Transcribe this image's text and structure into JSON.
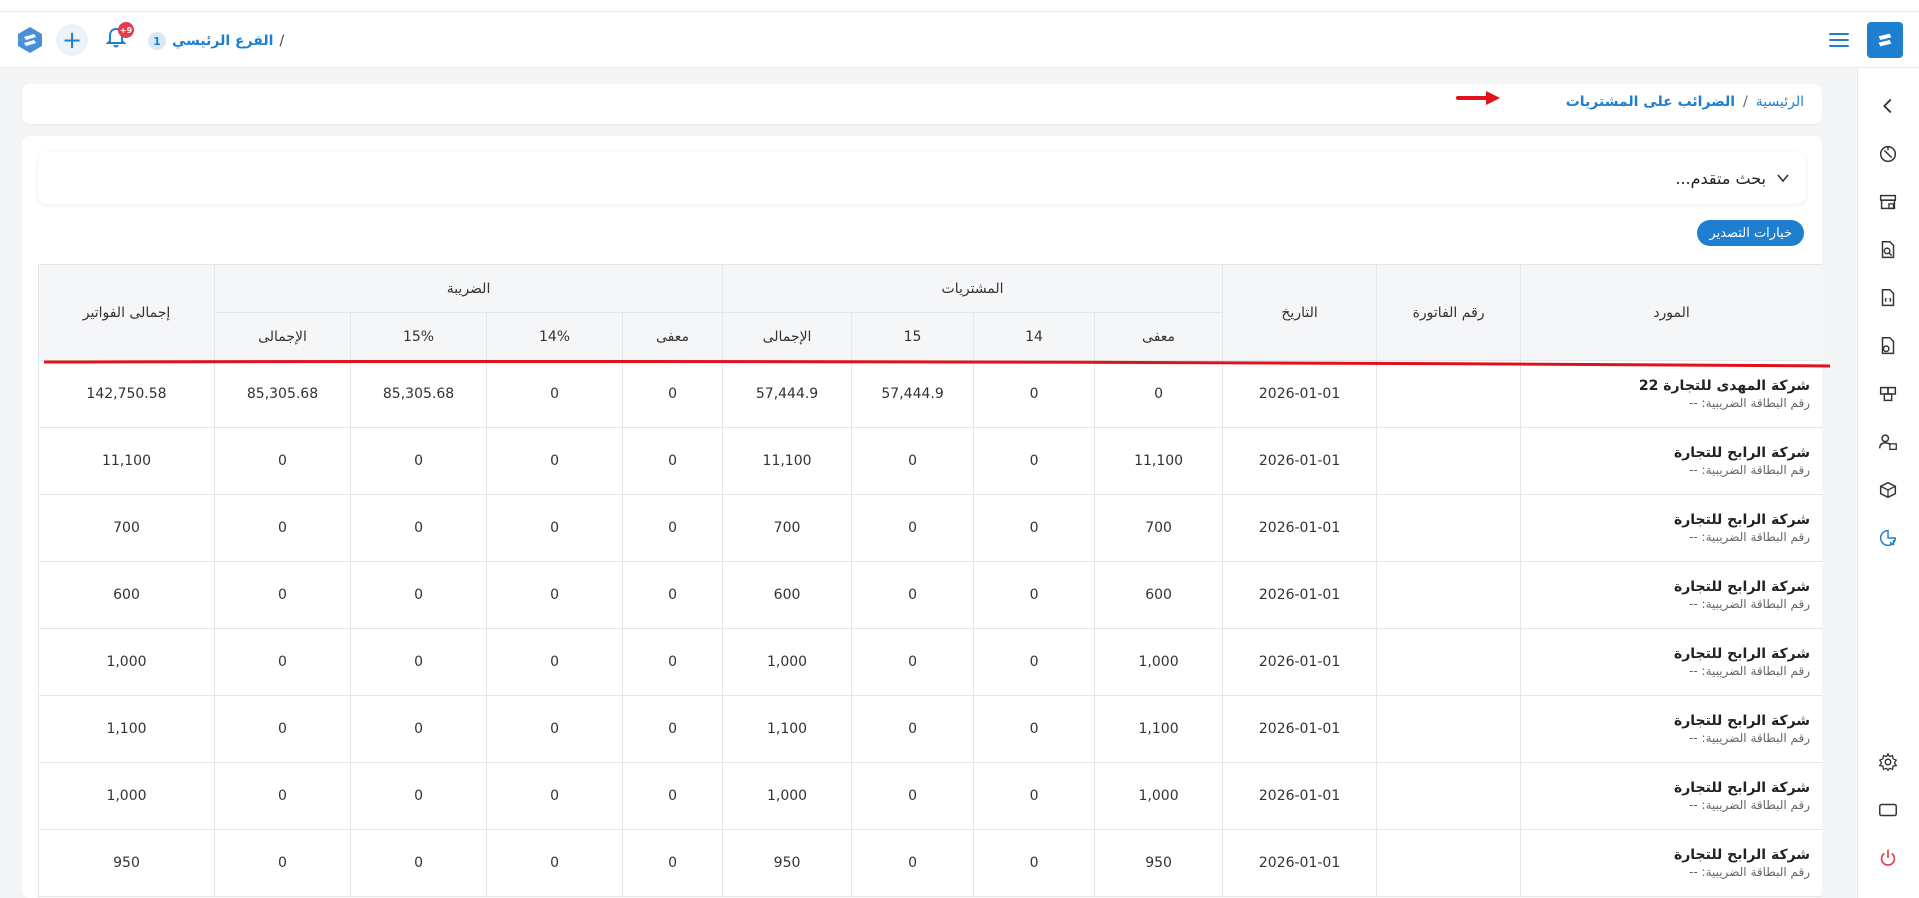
{
  "header": {
    "branch_number": "1",
    "branch_name": "الفرع الرئيسي",
    "branch_sep": "/",
    "notification_count": "+9"
  },
  "breadcrumb": {
    "home": "الرئيسية",
    "separator": "/",
    "current": "الضرائب على المشتريات"
  },
  "search": {
    "label": "بحث متقدم..."
  },
  "export_button": "خيارات التصدير",
  "table": {
    "headers": {
      "supplier": "المورد",
      "invoice_no": "رقم الفاتورة",
      "date": "التاريخ",
      "purchases": "المشتريات",
      "tax": "الضريبة",
      "invoices_total": "إجمالى الفواتير",
      "purchases_sub": [
        "معفى",
        "14",
        "15",
        "الإجمالى"
      ],
      "tax_sub": [
        "معفى",
        "14%",
        "15%",
        "الإجمالى"
      ]
    },
    "tax_card_label": "رقم البطاقة الضريبية: --",
    "rows": [
      {
        "supplier": "شركة المهدى للتجارة 22",
        "invoice": "",
        "date": "2026-01-01",
        "p_exempt": "0",
        "p14": "0",
        "p15": "57,444.9",
        "p_total": "57,444.9",
        "t_exempt": "0",
        "t14": "0",
        "t15": "85,305.68",
        "t_total": "85,305.68",
        "grand": "142,750.58"
      },
      {
        "supplier": "شركة الرابح للتجارة",
        "invoice": "",
        "date": "2026-01-01",
        "p_exempt": "11,100",
        "p14": "0",
        "p15": "0",
        "p_total": "11,100",
        "t_exempt": "0",
        "t14": "0",
        "t15": "0",
        "t_total": "0",
        "grand": "11,100"
      },
      {
        "supplier": "شركة الرابح للتجارة",
        "invoice": "",
        "date": "2026-01-01",
        "p_exempt": "700",
        "p14": "0",
        "p15": "0",
        "p_total": "700",
        "t_exempt": "0",
        "t14": "0",
        "t15": "0",
        "t_total": "0",
        "grand": "700"
      },
      {
        "supplier": "شركة الرابح للتجارة",
        "invoice": "",
        "date": "2026-01-01",
        "p_exempt": "600",
        "p14": "0",
        "p15": "0",
        "p_total": "600",
        "t_exempt": "0",
        "t14": "0",
        "t15": "0",
        "t_total": "0",
        "grand": "600"
      },
      {
        "supplier": "شركة الرابح للتجارة",
        "invoice": "",
        "date": "2026-01-01",
        "p_exempt": "1,000",
        "p14": "0",
        "p15": "0",
        "p_total": "1,000",
        "t_exempt": "0",
        "t14": "0",
        "t15": "0",
        "t_total": "0",
        "grand": "1,000"
      },
      {
        "supplier": "شركة الرابح للتجارة",
        "invoice": "",
        "date": "2026-01-01",
        "p_exempt": "1,100",
        "p14": "0",
        "p15": "0",
        "p_total": "1,100",
        "t_exempt": "0",
        "t14": "0",
        "t15": "0",
        "t_total": "0",
        "grand": "1,100"
      },
      {
        "supplier": "شركة الرابح للتجارة",
        "invoice": "",
        "date": "2026-01-01",
        "p_exempt": "1,000",
        "p14": "0",
        "p15": "0",
        "p_total": "1,000",
        "t_exempt": "0",
        "t14": "0",
        "t15": "0",
        "t_total": "0",
        "grand": "1,000"
      },
      {
        "supplier": "شركة الرابح للتجارة",
        "invoice": "",
        "date": "2026-01-01",
        "p_exempt": "950",
        "p14": "0",
        "p15": "0",
        "p_total": "950",
        "t_exempt": "0",
        "t14": "0",
        "t15": "0",
        "t_total": "0",
        "grand": "950"
      }
    ]
  },
  "sidebar": {
    "icons": [
      "collapse-chevron-icon",
      "dashboard-icon",
      "store-icon",
      "search-document-icon",
      "invoice-icon",
      "document-lock-icon",
      "boxes-icon",
      "users-icon",
      "inventory-icon",
      "reports-chart-icon",
      "settings-icon",
      "screen-icon",
      "power-icon"
    ]
  },
  "colors": {
    "accent": "#1e7fd0",
    "annotation_red": "#e0121b",
    "badge_red": "#e23c4f"
  }
}
